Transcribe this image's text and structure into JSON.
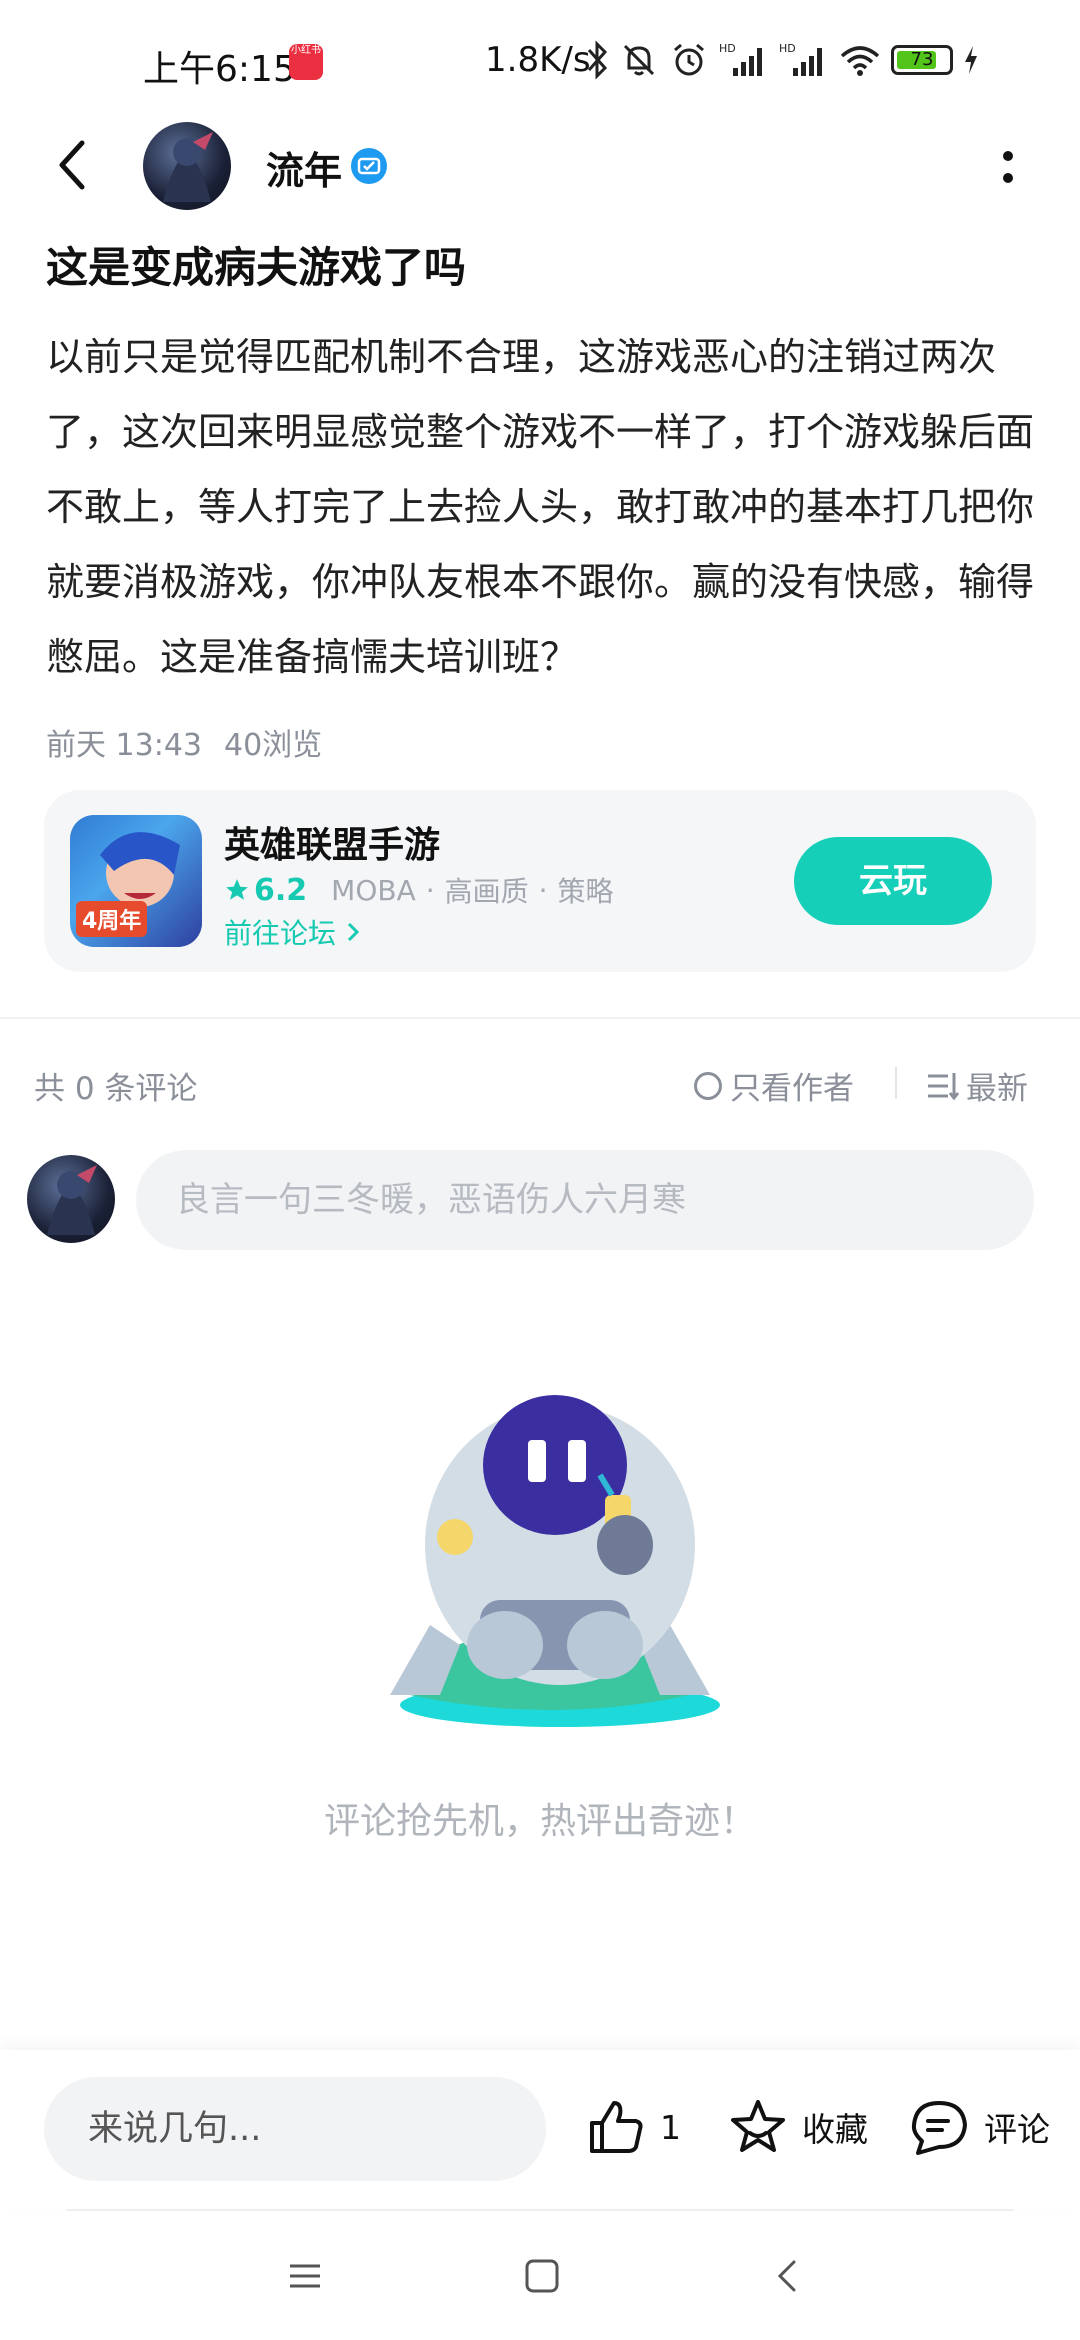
{
  "status_bar": {
    "time": "上午6:15",
    "speed": "1.8K/s",
    "battery": "73",
    "colors": {
      "battery_fill": "#52c41a",
      "xhs_badge": "#ea2f41"
    }
  },
  "post": {
    "author": "流年",
    "title": "这是变成病夫游戏了吗",
    "body": "以前只是觉得匹配机制不合理，这游戏恶心的注销过两次了，这次回来明显感觉整个游戏不一样了，打个游戏躲后面不敢上，等人打完了上去捡人头，敢打敢冲的基本打几把你就要消极游戏，你冲队友根本不跟你。赢的没有快感，输得憋屈。这是准备搞懦夫培训班？",
    "date": "前天 13:43",
    "views": "40浏览"
  },
  "game_card": {
    "name": "英雄联盟手游",
    "rating": "6.2",
    "tags": [
      "MOBA",
      "高画质",
      "策略"
    ],
    "forum_link": "前往论坛",
    "icon_badge": "4周年",
    "button": "云玩",
    "accent": "#16cfb9"
  },
  "comments": {
    "count_label": "共 0 条评论",
    "only_author": "只看作者",
    "sort": "最新",
    "input_placeholder": "良言一句三冬暖，恶语伤人六月寒",
    "empty_text": "评论抢先机，热评出奇迹！"
  },
  "bottom_bar": {
    "input_placeholder": "来说几句...",
    "like_count": "1",
    "favorite_label": "收藏",
    "comment_label": "评论"
  }
}
